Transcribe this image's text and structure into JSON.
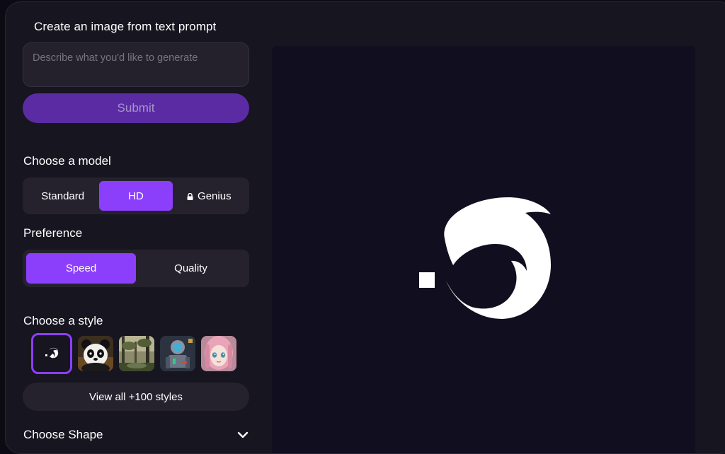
{
  "form": {
    "title": "Create an image from text prompt",
    "prompt_placeholder": "Describe what you'd like to generate",
    "prompt_value": "",
    "submit_label": "Submit"
  },
  "model": {
    "label": "Choose a model",
    "options": [
      "Standard",
      "HD",
      "Genius"
    ],
    "selected": "HD",
    "locked": [
      "Genius"
    ]
  },
  "preference": {
    "label": "Preference",
    "options": [
      "Speed",
      "Quality"
    ],
    "selected": "Speed"
  },
  "style": {
    "label": "Choose a style",
    "thumbnails": [
      "dolphin-logo-style",
      "panda-style",
      "forest-landscape-style",
      "armored-robot-style",
      "anime-portrait-style"
    ],
    "selected": "dolphin-logo-style",
    "view_all_label": "View all +100 styles"
  },
  "shape": {
    "label": "Choose Shape",
    "expand_icon": "chevron-down-icon"
  },
  "preview": {
    "image": "dolphin-logo"
  },
  "colors": {
    "accent": "#8c3ffb",
    "submit_bg": "#5b2ba4",
    "panel_bg": "#17151f",
    "preview_bg": "#110e20"
  }
}
